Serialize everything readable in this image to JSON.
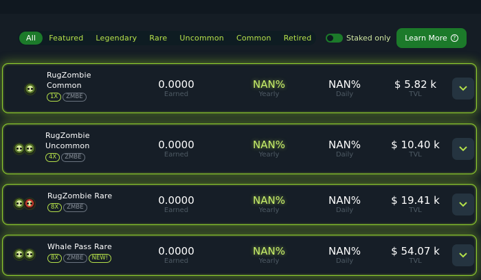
{
  "filters": [
    {
      "label": "All",
      "active": true
    },
    {
      "label": "Featured",
      "active": false
    },
    {
      "label": "Legendary",
      "active": false
    },
    {
      "label": "Rare",
      "active": false
    },
    {
      "label": "Uncommon",
      "active": false
    },
    {
      "label": "Common",
      "active": false
    },
    {
      "label": "Retired",
      "active": false
    }
  ],
  "staked_toggle": {
    "label": "Staked only",
    "on": true
  },
  "learn_more": {
    "label": "Learn More",
    "icon": "question-circle-icon"
  },
  "labels": {
    "earned": "Earned",
    "yearly": "Yearly",
    "daily": "Daily",
    "tvl": "TVL"
  },
  "pools": [
    {
      "name_line1": "RugZombie",
      "name_line2": "Common",
      "multiplier": "1X",
      "token": "ZMBE",
      "new_badge": "",
      "earned": "0.0000",
      "yearly": "NAN%",
      "daily": "NAN%",
      "tvl": "$ 5.82 k"
    },
    {
      "name_line1": "RugZombie",
      "name_line2": "Uncommon",
      "multiplier": "4X",
      "token": "ZMBE",
      "new_badge": "",
      "earned": "0.0000",
      "yearly": "NAN%",
      "daily": "NAN%",
      "tvl": "$ 10.40 k"
    },
    {
      "name_line1": "RugZombie Rare",
      "name_line2": "",
      "multiplier": "8X",
      "token": "ZMBE",
      "new_badge": "",
      "earned": "0.0000",
      "yearly": "NAN%",
      "daily": "NAN%",
      "tvl": "$ 19.41 k"
    },
    {
      "name_line1": "Whale Pass Rare",
      "name_line2": "",
      "multiplier": "8X",
      "token": "ZMBE",
      "new_badge": "NEW!",
      "earned": "0.0000",
      "yearly": "NAN%",
      "daily": "NAN%",
      "tvl": "$ 54.07 k"
    }
  ],
  "colors": {
    "accent": "#b6e24a",
    "button": "#1c7a2a",
    "border_glow": "#8fcf2d"
  }
}
